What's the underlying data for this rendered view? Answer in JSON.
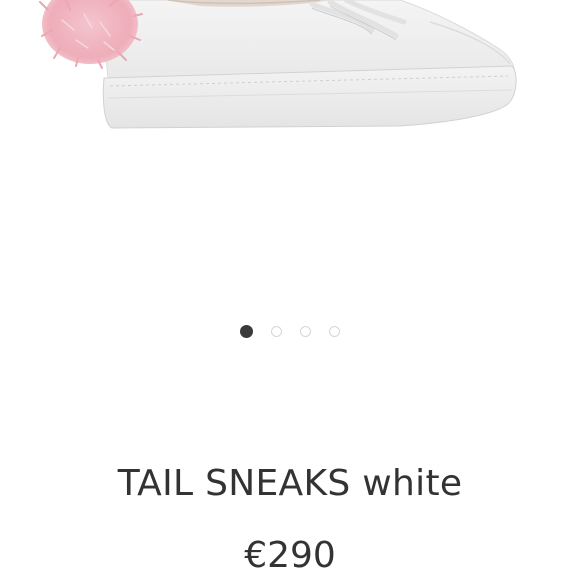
{
  "product": {
    "title": "TAIL SNEAKS white",
    "price": "€290",
    "image": {
      "icon": "sneaker-with-pink-fur-tail-image"
    }
  },
  "carousel": {
    "dots": [
      {
        "active": true
      },
      {
        "active": false
      },
      {
        "active": false
      },
      {
        "active": false
      }
    ]
  },
  "colors": {
    "background": "#ffffff",
    "text": "#333333",
    "dot_active": "#3a3a3a",
    "dot_inactive": "#d6d6d6",
    "fur": "#f2b8c2"
  }
}
